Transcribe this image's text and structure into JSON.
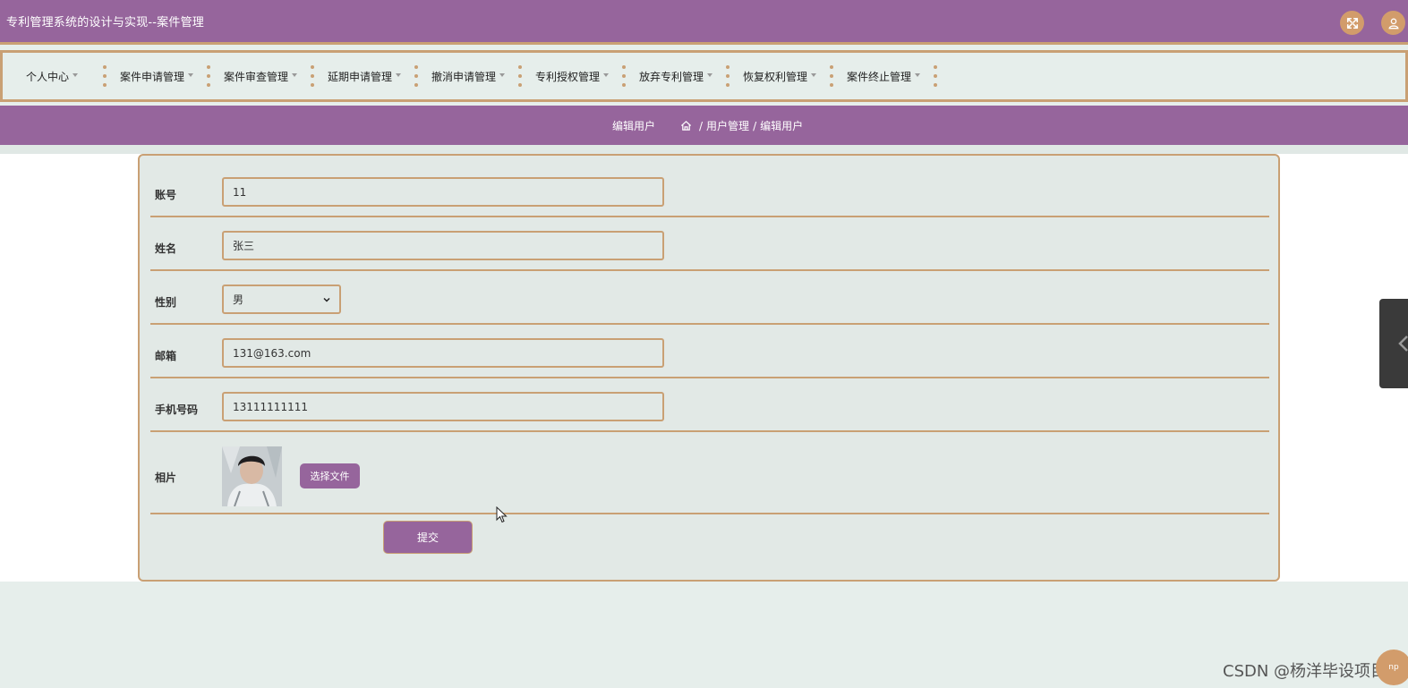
{
  "header": {
    "title": "专利管理系统的设计与实现--案件管理",
    "fullscreen_icon": "expand-icon",
    "user_icon": "user-icon"
  },
  "nav": {
    "items": [
      {
        "label": "个人中心"
      },
      {
        "label": "案件申请管理"
      },
      {
        "label": "案件审查管理"
      },
      {
        "label": "延期申请管理"
      },
      {
        "label": "撤消申请管理"
      },
      {
        "label": "专利授权管理"
      },
      {
        "label": "放弃专利管理"
      },
      {
        "label": "恢复权利管理"
      },
      {
        "label": "案件终止管理"
      }
    ]
  },
  "breadcrumb": {
    "page_title": "编辑用户",
    "path": [
      "用户管理",
      "编辑用户"
    ],
    "sep": "/"
  },
  "form": {
    "account": {
      "label": "账号",
      "value": "11"
    },
    "name": {
      "label": "姓名",
      "value": "张三"
    },
    "gender": {
      "label": "性别",
      "value": "男"
    },
    "email": {
      "label": "邮箱",
      "value": "131@163.com"
    },
    "phone": {
      "label": "手机号码",
      "value": "13111111111"
    },
    "photo": {
      "label": "相片",
      "button": "选择文件"
    },
    "submit": "提交"
  },
  "watermark": "CSDN @杨洋毕设项目",
  "corner_badge": "np",
  "colors": {
    "primary": "#96659c",
    "accent": "#c9a074",
    "icon_bg": "#d29c6b",
    "panel": "#e2e9e6"
  }
}
